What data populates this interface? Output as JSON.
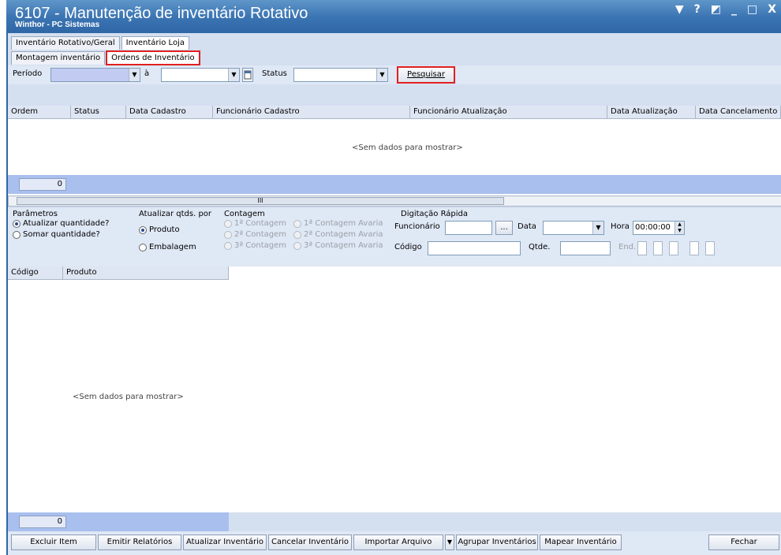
{
  "window": {
    "title": "6107 - Manutenção de inventário Rotativo",
    "subtitle": "Winthor - PC Sistemas",
    "controls": [
      "▼",
      "?",
      "◩",
      "_",
      "□",
      "X"
    ]
  },
  "tabs_top": [
    "Inventário Rotativo/Geral",
    "Inventário Loja"
  ],
  "tabs_sub": [
    "Montagem inventário",
    "Ordens de Inventário"
  ],
  "filter": {
    "periodo_label": "Período",
    "ate_label": "à",
    "status_label": "Status",
    "search_button": "Pesquisar",
    "calendar_icon": "calendar-icon"
  },
  "orders_grid": {
    "columns": [
      "Ordem",
      "Status",
      "Data Cadastro",
      "Funcionário Cadastro",
      "Funcionário Atualização",
      "Data Atualização",
      "Data Cancelamento"
    ],
    "empty_text": "<Sem dados para mostrar>",
    "footer_count": "0"
  },
  "parametros": {
    "title": "Parâmetros",
    "options": [
      "Atualizar quantidade?",
      "Somar quantidade?"
    ],
    "selected": "Atualizar quantidade?"
  },
  "atualizar_qtds": {
    "title": "Atualizar qtds. por",
    "options": [
      "Produto",
      "Embalagem"
    ],
    "selected": "Produto"
  },
  "contagem": {
    "title": "Contagem",
    "options": [
      "1ª Contagem",
      "1ª Contagem Avaria",
      "2ª Contagem",
      "2ª Contagem Avaria",
      "3ª Contagem",
      "3ª Contagem Avaria"
    ]
  },
  "digitacao": {
    "title": "Digitação Rápida",
    "funcionario_label": "Funcionário",
    "ellipsis_button": "...",
    "data_label": "Data",
    "hora_label": "Hora",
    "hora_value": "00:00:00",
    "codigo_label": "Código",
    "qtde_label": "Qtde.",
    "end_label": "End."
  },
  "products_grid": {
    "columns": [
      "Código",
      "Produto"
    ],
    "empty_text": "<Sem dados para mostrar>",
    "footer_count": "0"
  },
  "bottom_buttons": {
    "excluir": "Excluir Item",
    "emitir": "Emitir Relatórios",
    "atualizar": "Atualizar Inventário",
    "cancelar": "Cancelar Inventário",
    "importar": "Importar Arquivo",
    "agrupar": "Agrupar Inventários",
    "mapear": "Mapear Inventário",
    "fechar": "Fechar"
  }
}
